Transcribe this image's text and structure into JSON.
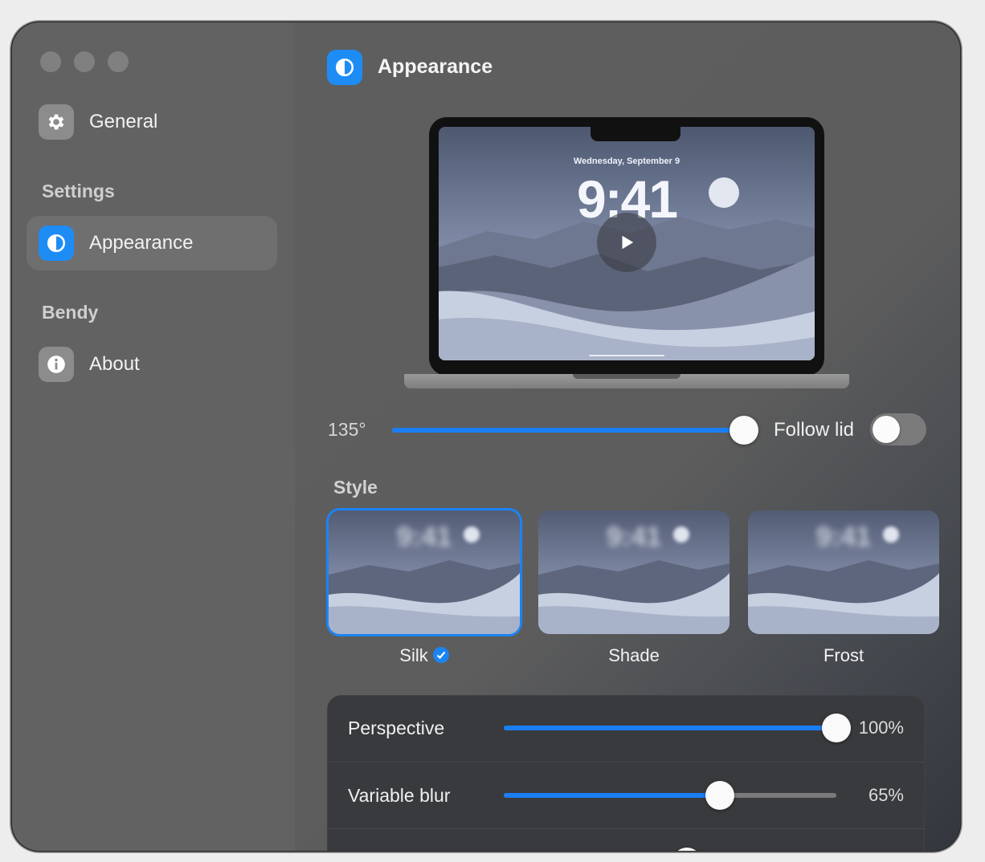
{
  "sidebar": {
    "items": [
      {
        "label": "General",
        "icon": "gear-icon"
      },
      {
        "label": "Appearance",
        "icon": "contrast-icon"
      },
      {
        "label": "About",
        "icon": "info-icon"
      }
    ],
    "sections": [
      "Settings",
      "Bendy"
    ]
  },
  "header": {
    "title": "Appearance",
    "icon": "contrast-icon"
  },
  "preview": {
    "date": "Wednesday, September 9",
    "time": "9:41"
  },
  "lid_angle": {
    "label": "135°",
    "value_fraction": 0.97
  },
  "follow_lid": {
    "label": "Follow lid",
    "on": false
  },
  "style": {
    "label": "Style",
    "options": [
      {
        "name": "Silk",
        "selected": true
      },
      {
        "name": "Shade",
        "selected": false
      },
      {
        "name": "Frost",
        "selected": false
      }
    ],
    "thumb_time": "9:41"
  },
  "settings": [
    {
      "label": "Perspective",
      "value": "100%",
      "fraction": 1.0
    },
    {
      "label": "Variable blur",
      "value": "65%",
      "fraction": 0.65
    }
  ],
  "colors": {
    "accent": "#1b7ef5",
    "sidebar": "#626262",
    "panel": "#393a3d"
  }
}
